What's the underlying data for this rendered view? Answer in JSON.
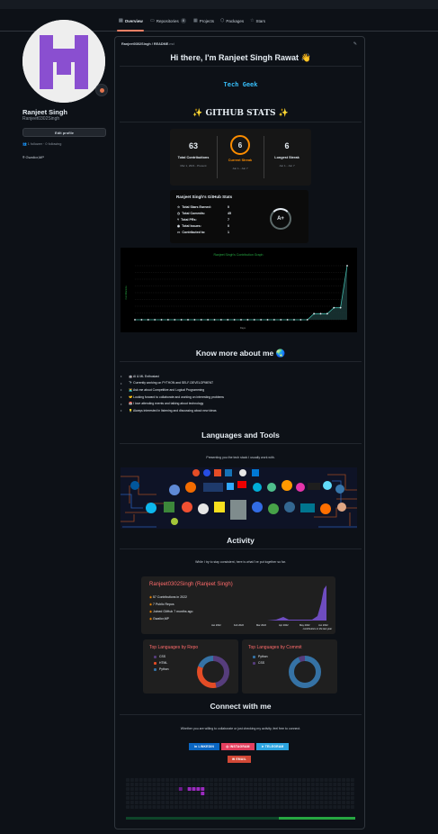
{
  "tabs": [
    {
      "label": "Overview"
    },
    {
      "label": "Repositories",
      "count": "8"
    },
    {
      "label": "Projects"
    },
    {
      "label": "Packages"
    },
    {
      "label": "Stars"
    }
  ],
  "profile": {
    "name": "Ranjeet Singh",
    "login": "Ranjeet0302Singh",
    "edit_label": "Edit profile",
    "followers": "1 follower",
    "following": "0 following",
    "location": "Gwalior,MP"
  },
  "readme": {
    "path": "Ranjeet0302Singh / README",
    "path_ext": ".md",
    "greeting": "Hi there, I'm Ranjeet Singh Rawat 👋",
    "typing_text": "Tech Geek",
    "stats_heading": "✨ GITHUB STATS ✨",
    "streak": {
      "total_num": "63",
      "total_label": "Total Contributions",
      "total_sub": "Mar 1, 2021 - Present",
      "current_num": "6",
      "current_label": "Current Streak",
      "current_sub": "Jun 1 - Jun 7",
      "longest_num": "6",
      "longest_label": "Longest Streak",
      "longest_sub": "Jun 1 - Jun 7"
    },
    "gh_stats": {
      "title": "Ranjeet Singh's GitHub Stats",
      "rows": [
        {
          "label": "Total Stars Earned:",
          "value": "0"
        },
        {
          "label": "Total Commits:",
          "value": "45"
        },
        {
          "label": "Total PRs:",
          "value": "7"
        },
        {
          "label": "Total Issues:",
          "value": "0"
        },
        {
          "label": "Contributed to:",
          "value": "1"
        }
      ],
      "grade": "A+"
    },
    "graph_title": "Ranjeet Singh's Contribution Graph",
    "graph_ylabel": "Contributions",
    "graph_xlabel": "Days",
    "about_heading": "Know more about me 🌏",
    "about_items": [
      "🤖 AI & ML Enthusiast",
      "🔭 Currently working on PYTHON and SELF-DEVELOPMENT",
      "👨‍💻 Ask me about Competitive and Logical Programming",
      "🤝 Looking forward to collaborate and working on interesting problems",
      "📅 I love attending events and talking about technology",
      "💡 Always interested in listening and discussing about new ideas"
    ],
    "tools_heading": "Languages and Tools",
    "tools_sub": "Presenting you the tech stack I usually work with.",
    "activity_heading": "Activity",
    "activity_sub": "While I try to stay consistent, here is what I've put together so far.",
    "activity_card": {
      "title": "Ranjeet0302Singh (Ranjeet Singh)",
      "lines": [
        "57 Contributions in 2022",
        "7 Public Repos",
        "Joined GitHub 7 months ago",
        "Gwalior,MP"
      ],
      "x_ticks": [
        "Jan 2022",
        "Feb 2022",
        "Mar 2022",
        "Apr 2022",
        "May 2022",
        "Jun 2022"
      ],
      "caption": "contributions in the last year"
    },
    "top_repo": {
      "title": "Top Languages by Repo",
      "langs": [
        "CSS",
        "HTML",
        "Python"
      ]
    },
    "top_commit": {
      "title": "Top Languages by Commit",
      "langs": [
        "Python",
        "CSS"
      ]
    },
    "connect_heading": "Connect with me",
    "connect_sub": "Whether you are willing to collaborate or just checking my activity, feel free to connect.",
    "badges": [
      {
        "label": "LINKEDIN",
        "color": "#0a66c2"
      },
      {
        "label": "INSTAGRAM",
        "color": "#e4405f"
      },
      {
        "label": "TELEGRAM",
        "color": "#2ca5e0"
      },
      {
        "label": "EMAIL",
        "color": "#d14836"
      }
    ]
  },
  "colors": {
    "accent": "#f78166",
    "streak": "#fb8c00",
    "card_title": "#ff6b6b"
  },
  "chart_data": {
    "type": "area",
    "title": "Ranjeet Singh's Contribution Graph",
    "xlabel": "Days",
    "ylabel": "Contributions",
    "values": [
      0,
      0,
      0,
      0,
      0,
      0,
      0,
      0,
      0,
      0,
      0,
      0,
      0,
      0,
      0,
      0,
      0,
      0,
      0,
      0,
      0,
      0,
      0,
      0,
      0,
      0,
      0,
      1,
      1,
      1,
      2,
      2,
      9
    ]
  }
}
